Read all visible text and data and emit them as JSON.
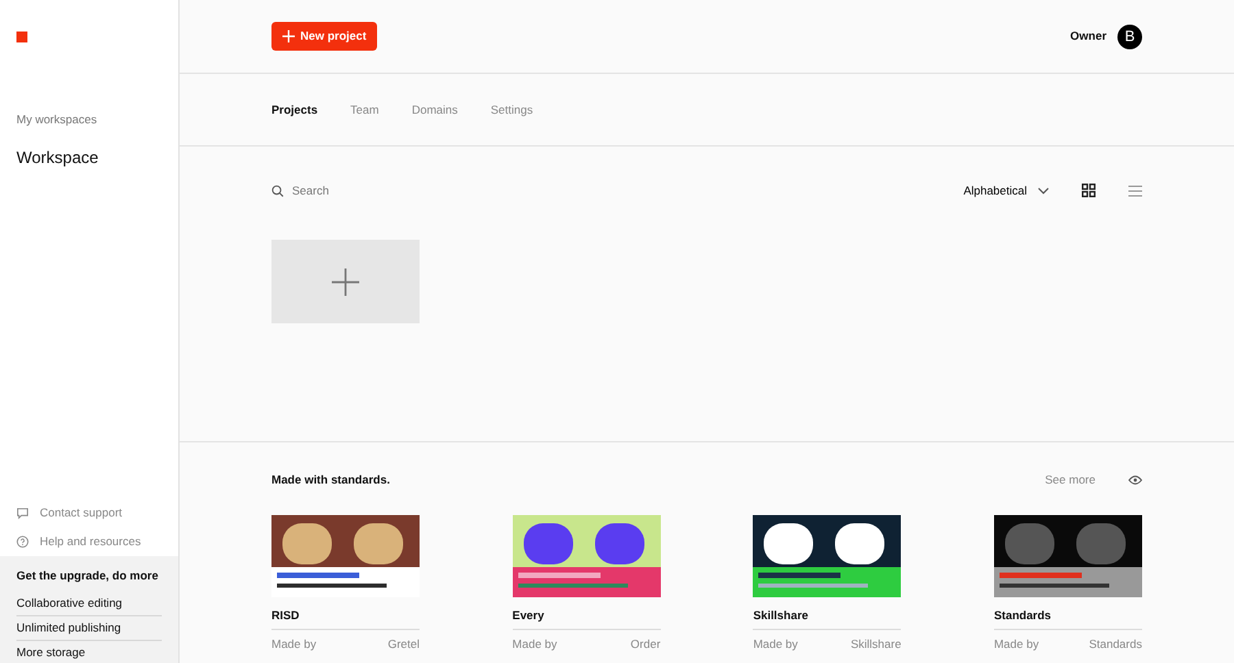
{
  "sidebar": {
    "workspaces_label": "My workspaces",
    "workspace": "Workspace",
    "links": [
      {
        "kind": "chat",
        "label": "Contact support"
      },
      {
        "kind": "help",
        "label": "Help and resources"
      }
    ],
    "upgrade": {
      "title": "Get the upgrade, do more",
      "items": [
        "Collaborative editing",
        "Unlimited publishing",
        "More storage"
      ]
    }
  },
  "header": {
    "new_button": "New project",
    "owner": "Owner",
    "avatar": "B"
  },
  "tabs": [
    {
      "label": "Projects",
      "selected": true
    },
    {
      "label": "Team",
      "selected": false
    },
    {
      "label": "Domains",
      "selected": false
    },
    {
      "label": "Settings",
      "selected": false
    }
  ],
  "toolbar": {
    "search_placeholder": "Search",
    "sort": "Alphabetical",
    "views": [
      {
        "kind": "grid",
        "selected": true
      },
      {
        "kind": "list",
        "selected": false
      }
    ]
  },
  "showcase": {
    "title": "Made with standards.",
    "see_more": "See more",
    "cards": [
      {
        "title": "RISD",
        "made_by": "Made by",
        "author": "Gretel"
      },
      {
        "title": "Every",
        "made_by": "Made by",
        "author": "Order"
      },
      {
        "title": "Skillshare",
        "made_by": "Made by",
        "author": "Skillshare"
      },
      {
        "title": "Standards",
        "made_by": "Made by",
        "author": "Standards"
      }
    ]
  }
}
